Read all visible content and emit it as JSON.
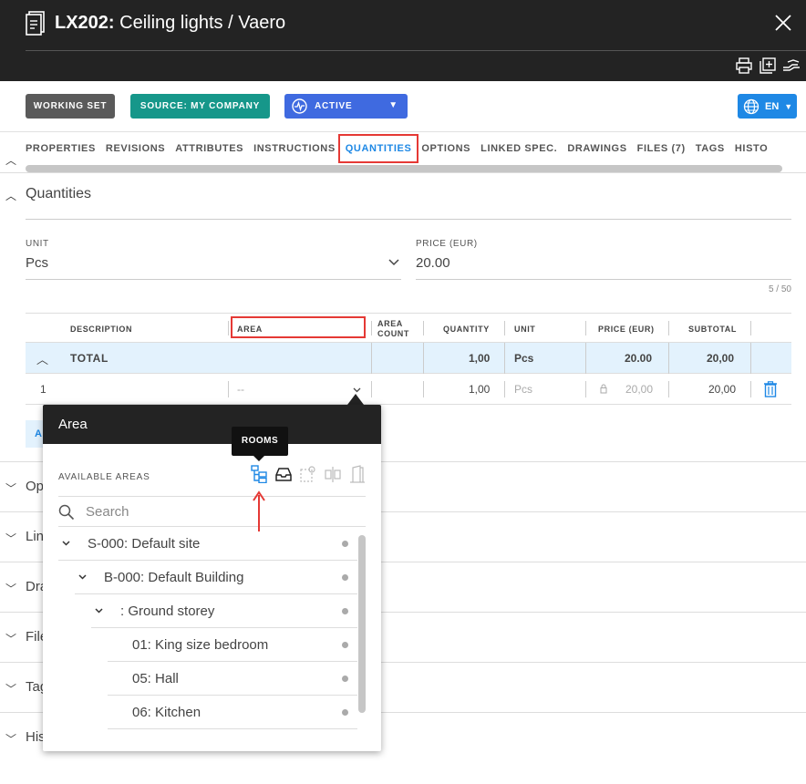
{
  "header": {
    "code": "LX202:",
    "name": "Ceiling lights / Vaero",
    "close_icon": "close-icon",
    "tools": [
      "print-icon",
      "add-copy-icon",
      "handoff-icon"
    ]
  },
  "toolbar": {
    "working_set": "WORKING SET",
    "source": "SOURCE: MY COMPANY",
    "status": "ACTIVE",
    "language": "EN"
  },
  "tabs": [
    "PROPERTIES",
    "REVISIONS",
    "ATTRIBUTES",
    "INSTRUCTIONS",
    "QUANTITIES",
    "OPTIONS",
    "LINKED SPEC.",
    "DRAWINGS",
    "FILES (7)",
    "TAGS",
    "HISTO"
  ],
  "selected_tab": "QUANTITIES",
  "quantities": {
    "section_title": "Quantities",
    "unit_label": "UNIT",
    "unit_value": "Pcs",
    "price_label": "PRICE (EUR)",
    "price_value": "20.00",
    "char_counter": "5 / 50",
    "columns": {
      "description": "DESCRIPTION",
      "area": "AREA",
      "area_count_1": "AREA",
      "area_count_2": "COUNT",
      "quantity": "QUANTITY",
      "unit": "UNIT",
      "price": "PRICE (EUR)",
      "subtotal": "SUBTOTAL"
    },
    "total_row": {
      "label": "TOTAL",
      "quantity": "1,00",
      "unit": "Pcs",
      "price": "20.00",
      "subtotal": "20,00"
    },
    "rows": [
      {
        "index": "1",
        "area": "--",
        "quantity": "1,00",
        "unit": "Pcs",
        "price": "20,00",
        "subtotal": "20,00"
      }
    ],
    "add_label": "A"
  },
  "collapsed_sections": [
    "Op",
    "Lin",
    "Dra",
    "File",
    "Tag",
    "His"
  ],
  "area_popup": {
    "title": "Area",
    "available_label": "AVAILABLE AREAS",
    "search_placeholder": "Search",
    "tooltip": "ROOMS",
    "tree": [
      {
        "label": "S-000: Default site",
        "level": 0,
        "expandable": true
      },
      {
        "label": "B-000: Default Building",
        "level": 1,
        "expandable": true
      },
      {
        "label": ": Ground storey",
        "level": 2,
        "expandable": true
      },
      {
        "label": "01: King size bedroom",
        "level": 3,
        "expandable": false
      },
      {
        "label": "05: Hall",
        "level": 3,
        "expandable": false
      },
      {
        "label": "06: Kitchen",
        "level": 3,
        "expandable": false
      }
    ]
  },
  "colors": {
    "header_bg": "#232323",
    "accent_blue": "#1e88e5",
    "source_green": "#16978a",
    "status_blue": "#3f6ae0",
    "highlight_red": "#e53935",
    "total_row_bg": "#e3f2fd"
  }
}
